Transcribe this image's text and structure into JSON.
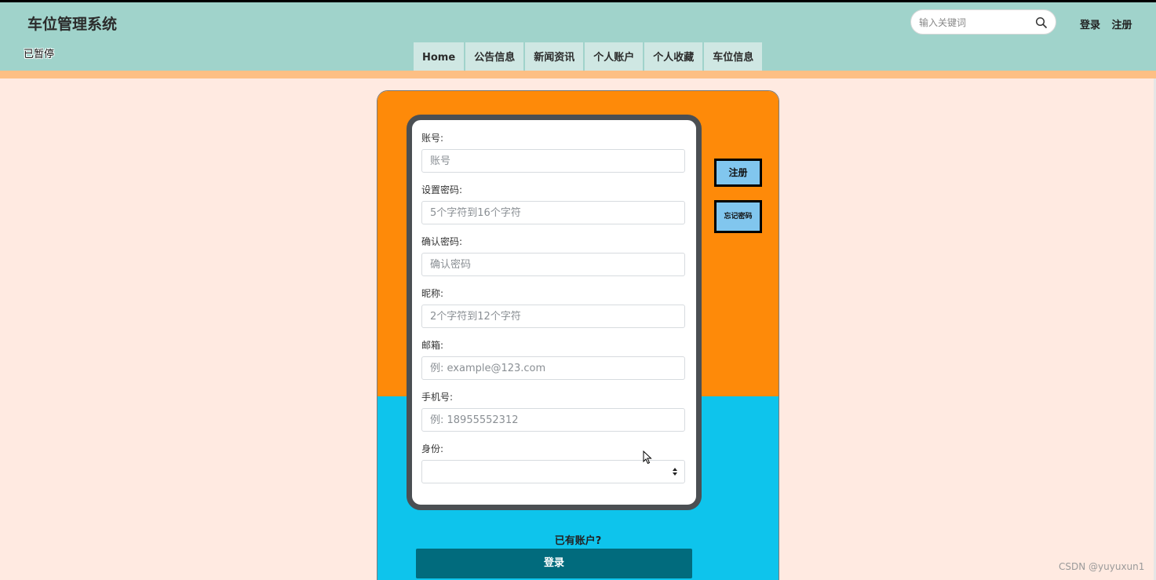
{
  "header": {
    "site_title": "车位管理系统",
    "paused_label": "已暂停",
    "search_placeholder": "输入关键词",
    "login_link": "登录",
    "register_link": "注册"
  },
  "nav": {
    "items": [
      {
        "label": "Home"
      },
      {
        "label": "公告信息"
      },
      {
        "label": "新闻资讯"
      },
      {
        "label": "个人账户"
      },
      {
        "label": "个人收藏"
      },
      {
        "label": "车位信息"
      }
    ]
  },
  "form": {
    "fields": [
      {
        "label": "账号:",
        "placeholder": "账号"
      },
      {
        "label": "设置密码:",
        "placeholder": "5个字符到16个字符"
      },
      {
        "label": "确认密码:",
        "placeholder": "确认密码"
      },
      {
        "label": "昵称:",
        "placeholder": "2个字符到12个字符"
      },
      {
        "label": "邮箱:",
        "placeholder": "例: example@123.com"
      },
      {
        "label": "手机号:",
        "placeholder": "例: 18955552312"
      }
    ],
    "identity_label": "身份:",
    "identity_value": ""
  },
  "side_buttons": {
    "register": "注册",
    "forgot_password": "忘记密码"
  },
  "footer_area": {
    "have_account": "已有账户?",
    "login_button": "登录"
  },
  "watermark": "CSDN @yuyuxun1",
  "colors": {
    "header_bg": "#a0d3cb",
    "panel_top": "#fe8a09",
    "panel_bottom": "#0ec4ec",
    "login_button": "#016b7d",
    "side_button": "#81c6ee"
  }
}
